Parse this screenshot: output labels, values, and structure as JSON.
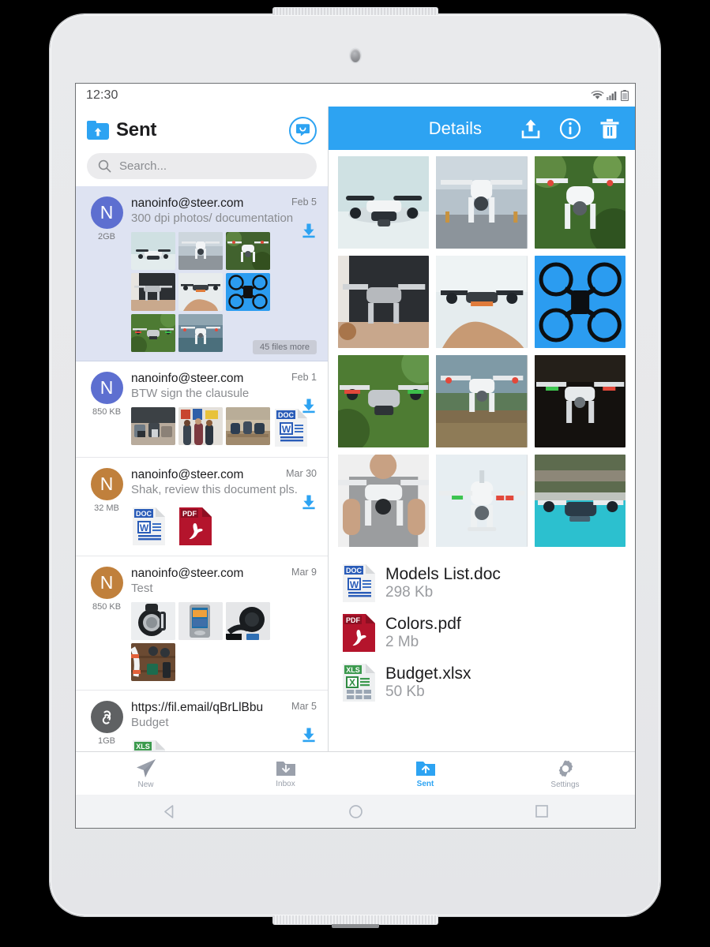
{
  "device": {
    "kind": "white-tablet"
  },
  "statusbar": {
    "time": "12:30",
    "icons": [
      "wifi-icon",
      "cellular-signal-icon",
      "battery-icon"
    ]
  },
  "left_pane": {
    "title": "Sent",
    "title_icon": "sent-folder-icon",
    "compose_icon": "compose-message-icon",
    "search": {
      "placeholder": "Search...",
      "value": "",
      "icon": "search-icon"
    },
    "more_badge": "45 files more",
    "mail_items": [
      {
        "avatar_letter": "N",
        "avatar_color": "#5d6fd0",
        "size": "2GB",
        "from": "nanoinfo@steer.com",
        "subject": "300 dpi photos/ documentation",
        "date": "Feb 5",
        "selected": true,
        "download_icon": "download-icon",
        "attachment_kind": "photos",
        "attachments": [
          "drone-white-on-table",
          "drone-snow-mountains",
          "drone-green-foliage",
          "drone-gray-indoor",
          "drone-on-hand",
          "drone-blue-background",
          "drone-flying-grass",
          "drone-white-lake"
        ],
        "more_badge": "45 files more"
      },
      {
        "avatar_letter": "N",
        "avatar_color": "#5d6fd0",
        "size": "850 KB",
        "from": "nanoinfo@steer.com",
        "subject": "BTW sign the clausule",
        "date": "Feb 1",
        "selected": false,
        "download_icon": "download-icon",
        "attachment_kind": "mixed",
        "attachments": [
          "office-people-computers",
          "team-group-photo",
          "open-office-meeting",
          "doc-file-icon"
        ]
      },
      {
        "avatar_letter": "N",
        "avatar_color": "#c0803c",
        "size": "32 MB",
        "from": "nanoinfo@steer.com",
        "subject": "Shak, review this document pls.",
        "date": "Mar 30",
        "selected": false,
        "download_icon": "download-icon",
        "attachment_kind": "docs",
        "attachments": [
          "doc-file-icon",
          "pdf-file-icon"
        ]
      },
      {
        "avatar_letter": "N",
        "avatar_color": "#c0803c",
        "size": "850 KB",
        "from": "nanoinfo@steer.com",
        "subject": "Test",
        "date": "Mar 9",
        "selected": false,
        "download_icon": null,
        "attachment_kind": "photos",
        "attachments": [
          "black-sport-watch",
          "media-player-device",
          "black-headphones",
          "gadgets-flatlay-wood"
        ]
      },
      {
        "avatar_letter": "link-icon",
        "avatar_color": "#5f6163",
        "size": "1GB",
        "from": "https://fil.email/qBrLlBbu",
        "subject": "Budget",
        "date": "Mar 5",
        "selected": false,
        "download_icon": "download-icon",
        "attachment_kind": "docs",
        "attachments": [
          "xls-file-icon"
        ]
      }
    ]
  },
  "right_pane": {
    "title": "Details",
    "actions": [
      {
        "name": "share-upload-icon",
        "label": "Share"
      },
      {
        "name": "info-icon",
        "label": "Info"
      },
      {
        "name": "trash-icon",
        "label": "Delete"
      }
    ],
    "header_color": "#2da3f2",
    "photos": [
      "drone-white-on-table",
      "drone-snow-mountains",
      "drone-green-foliage",
      "drone-gray-indoor-monitor",
      "drone-hovering-over-hand",
      "drone-blue-background",
      "drone-flying-over-grass",
      "drone-flying-field",
      "drone-dark-background",
      "man-holding-drone",
      "white-drone-studio",
      "drone-over-pool"
    ],
    "files": [
      {
        "icon": "doc-file-icon",
        "name": "Models List.doc",
        "size": "298 Kb"
      },
      {
        "icon": "pdf-file-icon",
        "name": "Colors.pdf",
        "size": "2 Mb"
      },
      {
        "icon": "xls-file-icon",
        "name": "Budget.xlsx",
        "size": "50 Kb"
      }
    ]
  },
  "tabbar": {
    "items": [
      {
        "label": "New",
        "icon": "paper-plane-icon",
        "active": false
      },
      {
        "label": "Inbox",
        "icon": "inbox-folder-icon",
        "active": false
      },
      {
        "label": "Sent",
        "icon": "sent-folder-icon",
        "active": true
      },
      {
        "label": "Settings",
        "icon": "gear-icon",
        "active": false
      }
    ],
    "active_color": "#2da3f2",
    "inactive_color": "#9aa0ab"
  },
  "navbar": {
    "items": [
      {
        "name": "android-back-icon"
      },
      {
        "name": "android-home-icon"
      },
      {
        "name": "android-recents-icon"
      }
    ]
  }
}
